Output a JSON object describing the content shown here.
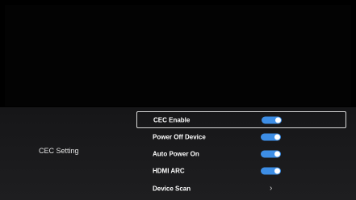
{
  "section": {
    "title": "CEC Setting"
  },
  "menu": {
    "items": [
      {
        "label": "CEC Enable",
        "control": "toggle",
        "state": "on"
      },
      {
        "label": "Power Off Device",
        "control": "toggle",
        "state": "on"
      },
      {
        "label": "Auto Power On",
        "control": "toggle",
        "state": "on"
      },
      {
        "label": "HDMI ARC",
        "control": "toggle",
        "state": "on"
      },
      {
        "label": "Device Scan",
        "control": "chevron",
        "icon": "chevron-right-icon"
      }
    ]
  },
  "colors": {
    "background": "#000000",
    "panel": "#1b1b1d",
    "toggle_on": "#3d8ee6",
    "focus_border": "#d8d8d8"
  }
}
